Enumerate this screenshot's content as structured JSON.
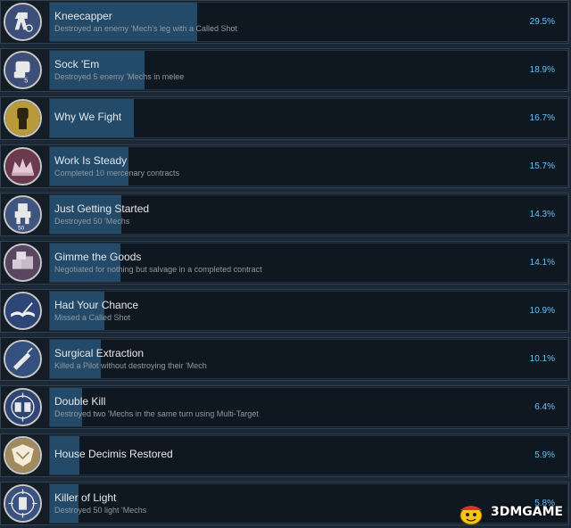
{
  "achievements": [
    {
      "title": "Kneecapper",
      "description": "Destroyed an enemy 'Mech's leg with a Called Shot",
      "percent_label": "29.5%",
      "percent": 29.5,
      "icon": "mech-leg-icon",
      "color": "#3b4e7a"
    },
    {
      "title": "Sock 'Em",
      "description": "Destroyed 5 enemy 'Mechs in melee",
      "percent_label": "18.9%",
      "percent": 18.9,
      "icon": "fist-icon",
      "color": "#3d4f78"
    },
    {
      "title": "Why We Fight",
      "description": "",
      "percent_label": "16.7%",
      "percent": 16.7,
      "icon": "raised-fist-icon",
      "color": "#b89a3a"
    },
    {
      "title": "Work Is Steady",
      "description": "Completed 10 mercenary contracts",
      "percent_label": "15.7%",
      "percent": 15.7,
      "icon": "crown-icon",
      "color": "#6b3a4e"
    },
    {
      "title": "Just Getting Started",
      "description": "Destroyed 50 'Mechs",
      "percent_label": "14.3%",
      "percent": 14.3,
      "icon": "mech-icon",
      "color": "#3f5580"
    },
    {
      "title": "Gimme the Goods",
      "description": "Negotiated for nothing but salvage in a completed contract",
      "percent_label": "14.1%",
      "percent": 14.1,
      "icon": "crates-icon",
      "color": "#5a4660"
    },
    {
      "title": "Had Your Chance",
      "description": "Missed a Called Shot",
      "percent_label": "10.9%",
      "percent": 10.9,
      "icon": "book-icon",
      "color": "#2e4578"
    },
    {
      "title": "Surgical Extraction",
      "description": "Killed a Pilot without destroying their 'Mech",
      "percent_label": "10.1%",
      "percent": 10.1,
      "icon": "scalpel-icon",
      "color": "#34507e"
    },
    {
      "title": "Double Kill",
      "description": "Destroyed two 'Mechs in the same turn using Multi-Target",
      "percent_label": "6.4%",
      "percent": 6.4,
      "icon": "crosshair-mechs-icon",
      "color": "#2f4576"
    },
    {
      "title": "House Decimis Restored",
      "description": "",
      "percent_label": "5.9%",
      "percent": 5.9,
      "icon": "crest-icon",
      "color": "#a08a5e"
    },
    {
      "title": "Killer of Light",
      "description": "Destroyed 50 light 'Mechs",
      "percent_label": "5.8%",
      "percent": 5.8,
      "icon": "crosshair-mech-icon",
      "color": "#3a5282"
    }
  ],
  "badge_number_sock_em": "5",
  "badge_number_just_getting_started": "50",
  "watermark": {
    "text": "3DMGAME",
    "icon": "cartoon-mascot-icon"
  }
}
